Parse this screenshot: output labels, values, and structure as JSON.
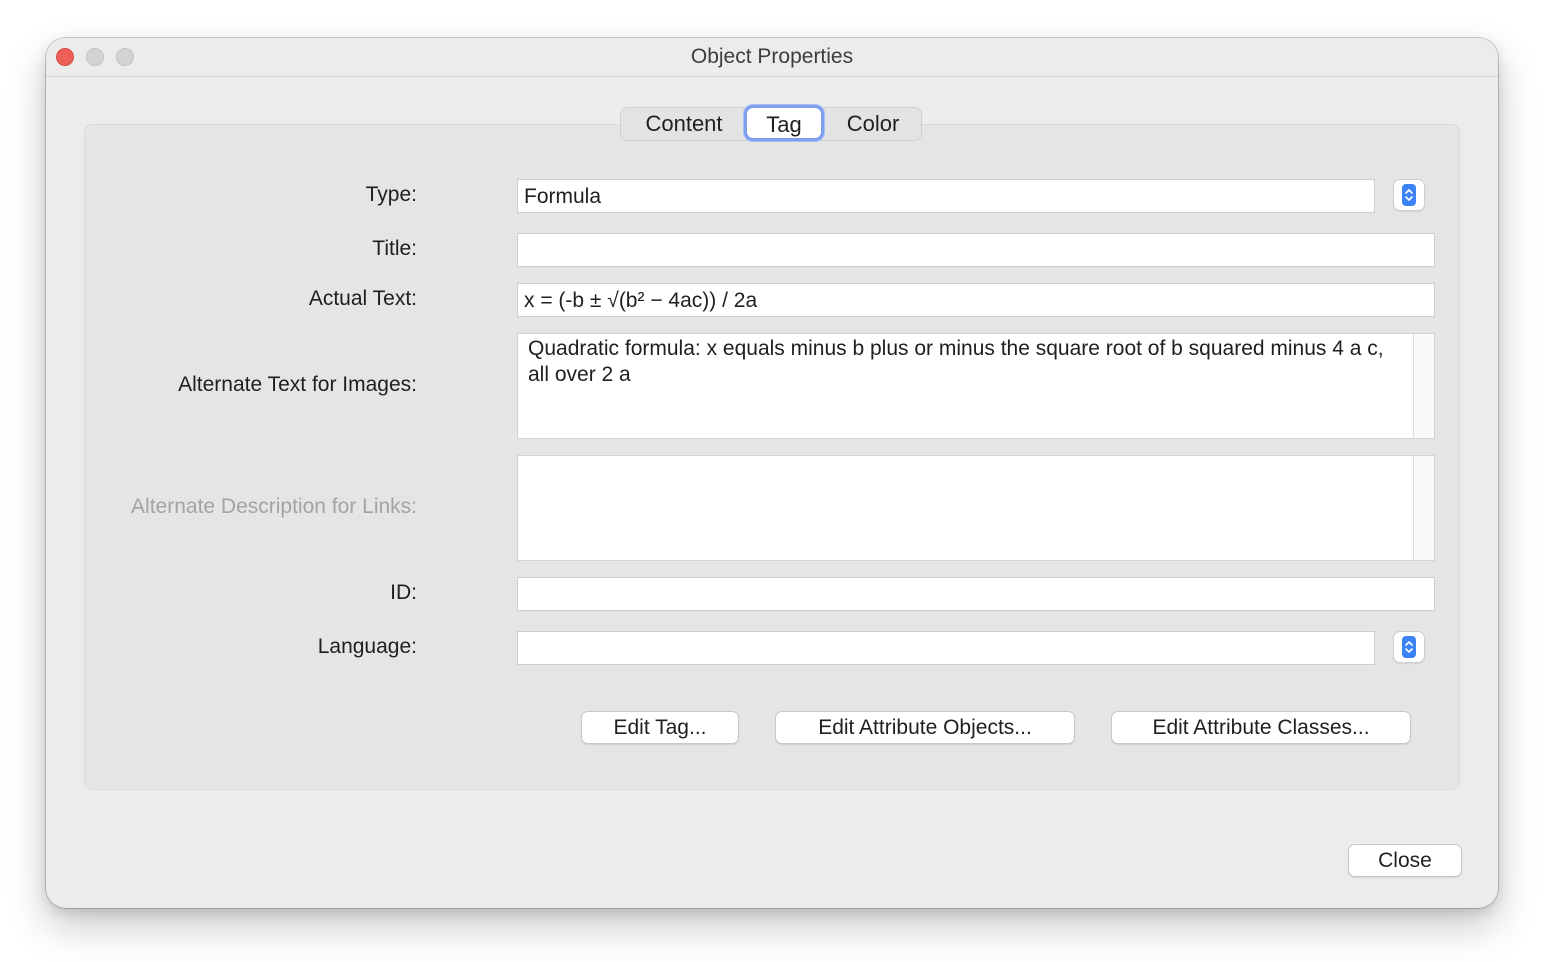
{
  "window": {
    "title": "Object Properties"
  },
  "tabs": [
    {
      "label": "Content"
    },
    {
      "label": "Tag"
    },
    {
      "label": "Color"
    }
  ],
  "selected_tab": "Tag",
  "form": {
    "type": {
      "label": "Type:",
      "value": "Formula"
    },
    "title": {
      "label": "Title:",
      "value": ""
    },
    "actual_text": {
      "label": "Actual Text:",
      "value": "x = (-b ± √(b² − 4ac)) / 2a"
    },
    "alt_text": {
      "label": "Alternate Text for Images:",
      "value": "Quadratic formula: x equals minus b plus or minus the square root of b squared minus 4 a c, all over 2 a"
    },
    "alt_desc": {
      "label": "Alternate Description for Links:",
      "value": ""
    },
    "id": {
      "label": "ID:",
      "value": ""
    },
    "language": {
      "label": "Language:",
      "value": ""
    }
  },
  "buttons": {
    "edit_tag": "Edit Tag...",
    "edit_attr_objects": "Edit Attribute Objects...",
    "edit_attr_classes": "Edit Attribute Classes...",
    "close": "Close"
  },
  "colors": {
    "accent": "#3b82f6",
    "focus_ring": "#7f9ff0",
    "close_light": "#ee5f57"
  }
}
